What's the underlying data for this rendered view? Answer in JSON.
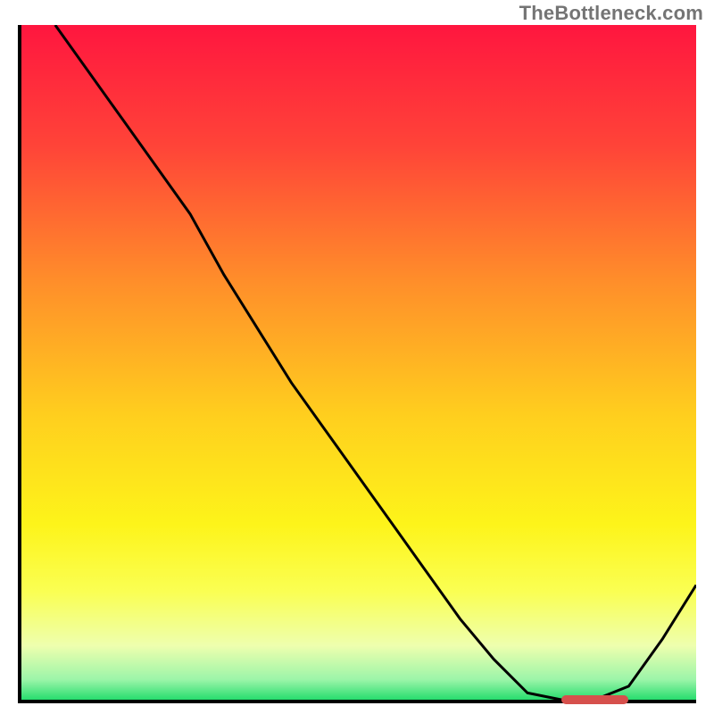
{
  "watermark": "TheBottleneck.com",
  "chart_data": {
    "type": "line",
    "title": "",
    "xlabel": "",
    "ylabel": "",
    "xlim": [
      0,
      100
    ],
    "ylim": [
      0,
      100
    ],
    "grid": false,
    "series": [
      {
        "name": "bottleneck-curve",
        "x": [
          5,
          10,
          15,
          20,
          25,
          30,
          35,
          40,
          45,
          50,
          55,
          60,
          65,
          70,
          75,
          80,
          85,
          90,
          95,
          100
        ],
        "values": [
          100,
          93,
          86,
          79,
          72,
          63,
          55,
          47,
          40,
          33,
          26,
          19,
          12,
          6,
          1,
          0,
          0,
          2,
          9,
          17
        ]
      }
    ],
    "markers": [
      {
        "name": "optimal-range",
        "x_start": 80,
        "x_end": 90,
        "y": 0
      }
    ],
    "background_gradient": {
      "stops": [
        {
          "pct": 0,
          "color": "#ff163f"
        },
        {
          "pct": 18,
          "color": "#ff4438"
        },
        {
          "pct": 38,
          "color": "#ff8e2a"
        },
        {
          "pct": 58,
          "color": "#ffcf1e"
        },
        {
          "pct": 74,
          "color": "#fdf41a"
        },
        {
          "pct": 84,
          "color": "#faff53"
        },
        {
          "pct": 92,
          "color": "#eeffae"
        },
        {
          "pct": 97,
          "color": "#9cf5a9"
        },
        {
          "pct": 100,
          "color": "#27dd6e"
        }
      ]
    }
  }
}
